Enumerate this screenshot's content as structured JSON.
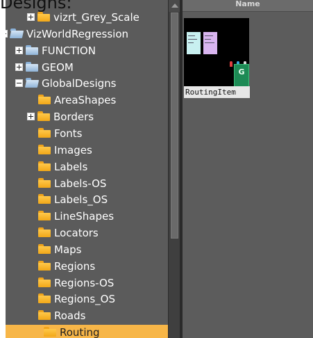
{
  "caption": "Designs:",
  "tree": {
    "items": [
      {
        "label": "vizrt_Grey_Scale",
        "icon": "folder-yellow",
        "expander": "plus",
        "level": 2
      },
      {
        "label": "VizWorldRegression",
        "icon": "folder-blue",
        "expander": "minus",
        "level": 0
      },
      {
        "label": "FUNCTION",
        "icon": "folder-blue",
        "expander": "plus",
        "level": 1
      },
      {
        "label": "GEOM",
        "icon": "folder-blue",
        "expander": "plus",
        "level": 1
      },
      {
        "label": "GlobalDesigns",
        "icon": "folder-blue",
        "expander": "minus",
        "level": 1
      },
      {
        "label": "AreaShapes",
        "icon": "folder-yellow",
        "expander": "none",
        "level": 2
      },
      {
        "label": "Borders",
        "icon": "folder-yellow",
        "expander": "plus",
        "level": 2
      },
      {
        "label": "Fonts",
        "icon": "folder-yellow",
        "expander": "none",
        "level": 2
      },
      {
        "label": "Images",
        "icon": "folder-yellow",
        "expander": "none",
        "level": 2
      },
      {
        "label": "Labels",
        "icon": "folder-yellow",
        "expander": "none",
        "level": 2
      },
      {
        "label": "Labels-OS",
        "icon": "folder-yellow",
        "expander": "none",
        "level": 2
      },
      {
        "label": "Labels_OS",
        "icon": "folder-yellow",
        "expander": "none",
        "level": 2
      },
      {
        "label": "LineShapes",
        "icon": "folder-yellow",
        "expander": "none",
        "level": 2
      },
      {
        "label": "Locators",
        "icon": "folder-yellow",
        "expander": "none",
        "level": 2
      },
      {
        "label": "Maps",
        "icon": "folder-yellow",
        "expander": "none",
        "level": 2
      },
      {
        "label": "Regions",
        "icon": "folder-yellow",
        "expander": "none",
        "level": 2
      },
      {
        "label": "Regions-OS",
        "icon": "folder-yellow",
        "expander": "none",
        "level": 2
      },
      {
        "label": "Regions_OS",
        "icon": "folder-yellow",
        "expander": "none",
        "level": 2
      },
      {
        "label": "Roads",
        "icon": "folder-yellow",
        "expander": "none",
        "level": 2
      },
      {
        "label": "Routing",
        "icon": "folder-yellow",
        "expander": "none",
        "level": 2,
        "selected": true
      }
    ]
  },
  "content": {
    "column_header": "Name",
    "items": [
      {
        "label": "RoutingItem",
        "thumbnail_letter": "G"
      }
    ]
  },
  "colors": {
    "tree_background": "#5b5b5b",
    "selection": "#f7b648",
    "folder_yellow": "#f2a818",
    "folder_blue": "#8fb4d8",
    "content_background": "#5c5c5c"
  }
}
